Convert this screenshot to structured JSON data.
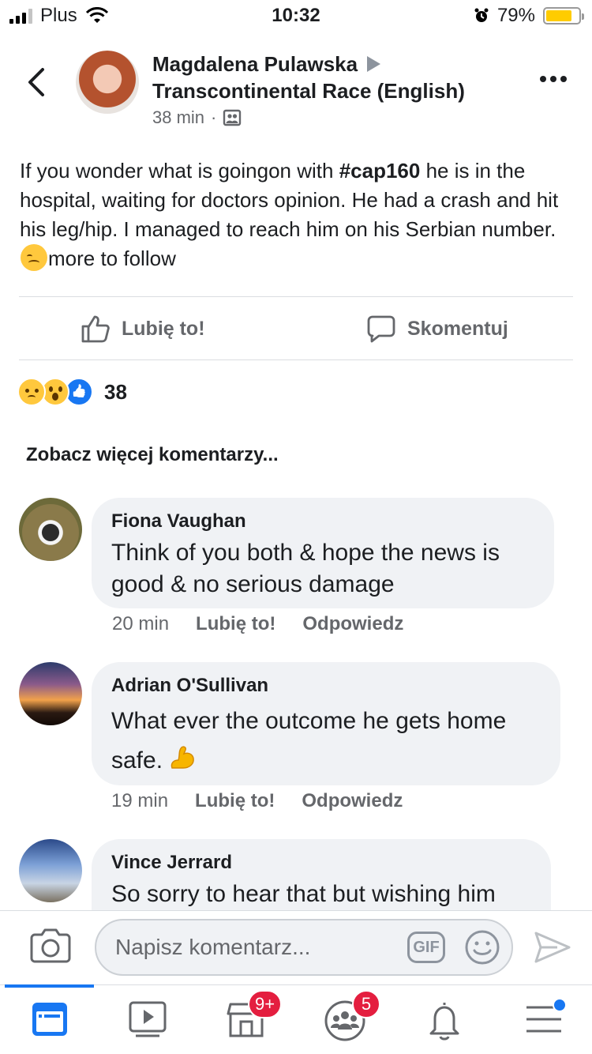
{
  "status_bar": {
    "carrier": "Plus",
    "time": "10:32",
    "battery": "79%",
    "battery_level": 0.79
  },
  "post": {
    "author": "Magdalena Pulawska",
    "group": "Transcontinental Race (English)",
    "time": "38 min",
    "text_before": "If you wonder what is goingon with ",
    "hashtag": "#cap160",
    "text_after": " he is in the hospital, waiting for doctors opinion. He had a crash and hit his leg/hip. I managed to reach him on his Serbian number.",
    "text_end": "more to follow",
    "like_label": "Lubię to!",
    "comment_label": "Skomentuj",
    "reaction_count": "38",
    "see_more": "Zobacz więcej komentarzy..."
  },
  "comments": [
    {
      "name": "Fiona Vaughan",
      "text": "Think of you both & hope the news is good & no serious damage",
      "time": "20 min",
      "like": "Lubię to!",
      "reply": "Odpowiedz"
    },
    {
      "name": "Adrian O'Sullivan",
      "text": "What ever the outcome he gets home safe.",
      "time": "19 min",
      "like": "Lubię to!",
      "reply": "Odpowiedz"
    },
    {
      "name": "Vince Jerrard",
      "text": "So sorry to hear that but wishing him"
    }
  ],
  "composer": {
    "placeholder": "Napisz komentarz...",
    "gif_label": "GIF"
  },
  "tab_bar": {
    "marketplace_badge": "9+",
    "groups_badge": "5"
  },
  "colors": {
    "accent": "#1877f2",
    "badge": "#e41e3f",
    "bubble": "#f0f2f5",
    "secondary_text": "#65676b"
  },
  "icons": [
    "back-icon",
    "more-icon",
    "group-icon",
    "like-icon",
    "comment-icon",
    "camera-icon",
    "gif-icon",
    "emoji-icon",
    "send-icon",
    "feed-icon",
    "watch-icon",
    "marketplace-icon",
    "groups-icon",
    "notifications-icon",
    "menu-icon"
  ]
}
